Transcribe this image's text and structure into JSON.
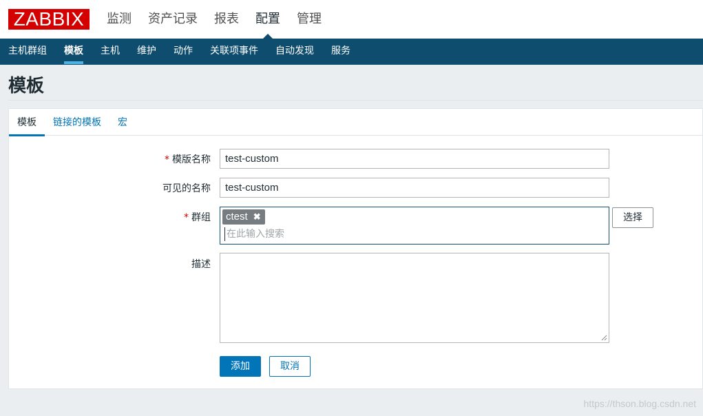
{
  "header": {
    "logo": "ZABBIX",
    "menu": [
      {
        "label": "监测"
      },
      {
        "label": "资产记录"
      },
      {
        "label": "报表"
      },
      {
        "label": "配置",
        "active": true
      },
      {
        "label": "管理"
      }
    ]
  },
  "subnav": {
    "items": [
      {
        "label": "主机群组"
      },
      {
        "label": "模板",
        "active": true
      },
      {
        "label": "主机"
      },
      {
        "label": "维护"
      },
      {
        "label": "动作"
      },
      {
        "label": "关联项事件"
      },
      {
        "label": "自动发现"
      },
      {
        "label": "服务"
      }
    ]
  },
  "page": {
    "title": "模板"
  },
  "tabs": [
    {
      "label": "模板",
      "active": true
    },
    {
      "label": "链接的模板"
    },
    {
      "label": "宏"
    }
  ],
  "form": {
    "required_mark": "*",
    "template_name_label": "模版名称",
    "template_name_value": "test-custom",
    "visible_name_label": "可见的名称",
    "visible_name_value": "test-custom",
    "groups_label": "群组",
    "groups_chip": "ctest",
    "groups_chip_remove": "✖",
    "groups_placeholder": "在此输入搜索",
    "select_button": "选择",
    "description_label": "描述",
    "description_value": "",
    "add_button": "添加",
    "cancel_button": "取消"
  },
  "watermark": "https://thson.blog.csdn.net",
  "colors": {
    "brand_red": "#d40000",
    "nav_bg": "#0e4d6e",
    "accent_blue": "#0275b8",
    "nav_active_underline": "#4fb3e8"
  }
}
